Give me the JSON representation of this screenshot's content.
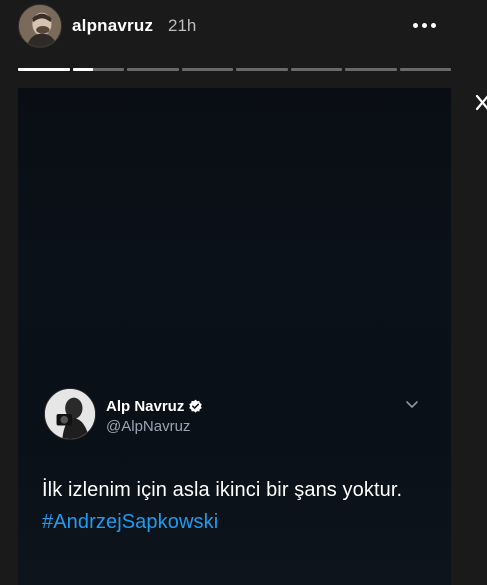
{
  "story": {
    "username": "alpnavruz",
    "timestamp": "21h",
    "progress": {
      "segments": 8,
      "active_index": 1,
      "active_fraction": 0.4
    }
  },
  "tweet": {
    "display_name": "Alp Navruz",
    "handle": "@AlpNavruz",
    "text": "İlk izlenim için asla ikinci bir şans yoktur.",
    "hashtag": "#AndrzejSapkowski"
  },
  "colors": {
    "background": "#1a1a1a",
    "media_bg": "#0b1119",
    "hashtag": "#1d9bf0",
    "verified": "#ffffff",
    "handle": "#9aa5b1"
  },
  "icons": {
    "more": "more-horizontal-icon",
    "close": "close-icon",
    "verified": "verified-badge-icon",
    "chevron": "chevron-down-icon"
  }
}
